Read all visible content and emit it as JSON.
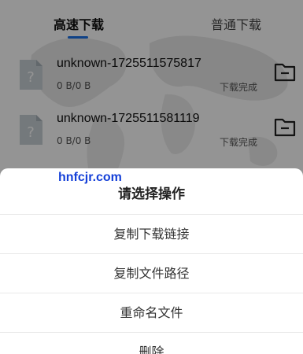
{
  "tabs": {
    "active_label": "高速下载",
    "inactive_label": "普通下载"
  },
  "downloads": [
    {
      "name": "unknown-1725511575817",
      "size": "0 B/0 B",
      "status": "下载完成",
      "icon": "file-unknown-icon"
    },
    {
      "name": "unknown-1725511581119",
      "size": "0 B/0 B",
      "status": "下载完成",
      "icon": "file-unknown-icon"
    }
  ],
  "watermark": "hnfcjr.com",
  "sheet": {
    "title": "请选择操作",
    "actions": [
      "复制下载链接",
      "复制文件路径",
      "重命名文件",
      "删除"
    ]
  },
  "colors": {
    "accent": "#1a73e8",
    "watermark": "#1540d8",
    "overlay": "rgba(0,0,0,0.42)"
  }
}
